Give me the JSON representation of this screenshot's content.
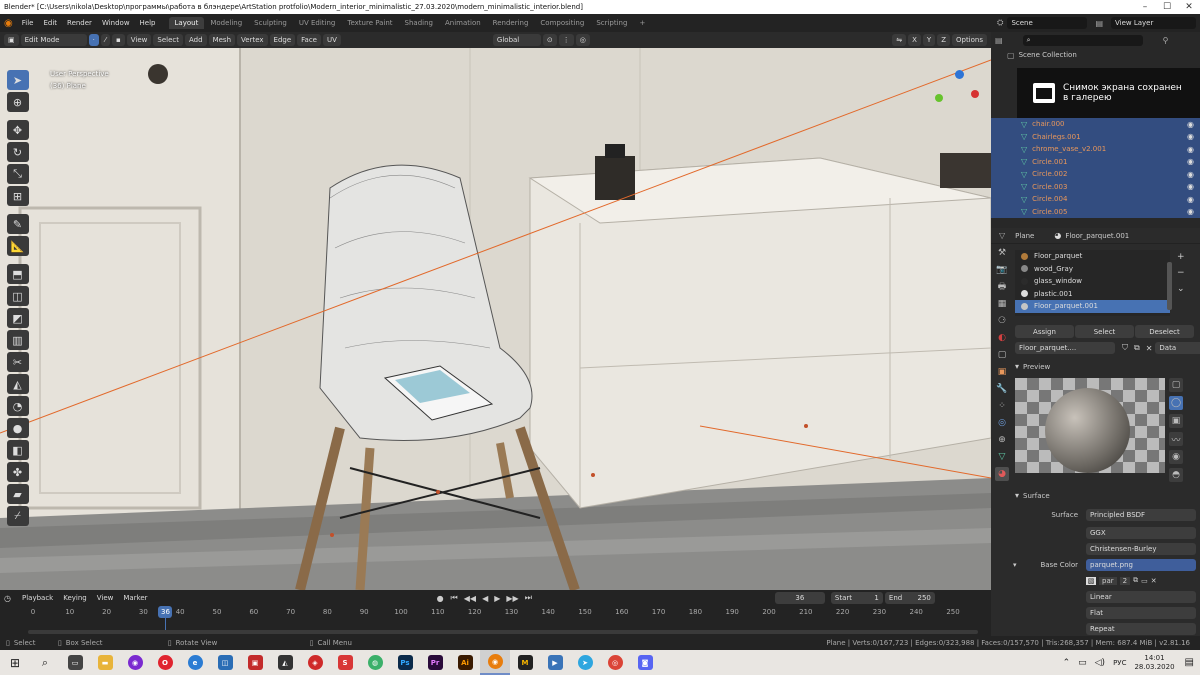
{
  "window_title": "Blender* [C:\\Users\\nikola\\Desktop\\программы\\работа в блэндере\\ArtStation protfolio\\Modern_interior_minimalistic_27.03.2020\\modern_minimalistic_interior.blend]",
  "menu": [
    "File",
    "Edit",
    "Render",
    "Window",
    "Help"
  ],
  "workspaces": [
    "Layout",
    "Modeling",
    "Sculpting",
    "UV Editing",
    "Texture Paint",
    "Shading",
    "Animation",
    "Rendering",
    "Compositing",
    "Scripting"
  ],
  "scene": "Scene",
  "view_layer": "View Layer",
  "viewport_header": {
    "mode": "Edit Mode",
    "menus": [
      "View",
      "Select",
      "Add",
      "Mesh",
      "Vertex",
      "Edge",
      "Face",
      "UV"
    ],
    "transform": "Global",
    "axes": [
      "X",
      "Y",
      "Z"
    ],
    "options": "Options"
  },
  "viewport": {
    "perspective_label": "User Perspective",
    "object_label": "(36) Plane"
  },
  "outliner": {
    "title": "Scene Collection",
    "items": [
      "chair.000",
      "Chairlegs.001",
      "chrome_vase_v2.001",
      "Circle.001",
      "Circle.002",
      "Circle.003",
      "Circle.004",
      "Circle.005"
    ]
  },
  "toast": {
    "line1": "Снимок экрана сохранен",
    "line2": "в галерею"
  },
  "properties": {
    "object": "Plane",
    "material": "Floor_parquet.001",
    "materials": [
      {
        "name": "Floor_parquet",
        "color": "#b07a3a"
      },
      {
        "name": "wood_Gray",
        "color": "#888888"
      },
      {
        "name": "glass_window",
        "color": "#2b2b2b"
      },
      {
        "name": "plastic.001",
        "color": "#dddddd"
      },
      {
        "name": "Floor_parquet.001",
        "color": "#c5c5c5"
      }
    ],
    "assign": "Assign",
    "select": "Select",
    "deselect": "Deselect",
    "slot_name": "Floor_parquet....",
    "link": "Data",
    "preview_label": "Preview",
    "surface_label": "Surface",
    "surface_field": "Surface",
    "surface_value": "Principled BSDF",
    "distribution": "GGX",
    "subsurface": "Christensen-Burley",
    "base_color_label": "Base Color",
    "base_color_value": "parquet.png",
    "image_short": "par",
    "image_users": "2",
    "interp": "Linear",
    "projection": "Flat",
    "extension": "Repeat"
  },
  "timeline": {
    "menus": [
      "Playback",
      "Keying",
      "View",
      "Marker"
    ],
    "current_frame": "36",
    "start_label": "Start",
    "start": "1",
    "end_label": "End",
    "end": "250",
    "ticks": [
      "0",
      "10",
      "20",
      "30",
      "40",
      "50",
      "60",
      "70",
      "80",
      "90",
      "100",
      "110",
      "120",
      "130",
      "140",
      "150",
      "160",
      "170",
      "180",
      "190",
      "200",
      "210",
      "220",
      "230",
      "240",
      "250"
    ]
  },
  "status": {
    "select": "Select",
    "box_select": "Box Select",
    "rotate": "Rotate View",
    "call_menu": "Call Menu",
    "stats": "Plane | Verts:0/167,723 | Edges:0/323,988 | Faces:0/157,570 | Tris:268,357 | Mem: 687.4 MiB | v2.81.16"
  },
  "taskbar": {
    "lang": "РУС",
    "time": "14:01",
    "date": "28.03.2020"
  }
}
